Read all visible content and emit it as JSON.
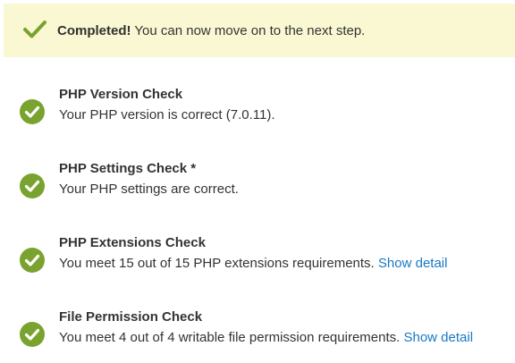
{
  "banner": {
    "icon": "checkmark-icon",
    "strong": "Completed!",
    "message": " You can now move on to the next step.",
    "background": "#f9f8d2",
    "icon_color": "#79a22e"
  },
  "checks": [
    {
      "icon": "success-check-icon",
      "title": "PHP Version Check",
      "description": "Your PHP version is correct (7.0.11)."
    },
    {
      "icon": "success-check-icon",
      "title": "PHP Settings Check *",
      "description": "Your PHP settings are correct."
    },
    {
      "icon": "success-check-icon",
      "title": "PHP Extensions Check",
      "description": "You meet 15 out of 15 PHP extensions requirements.",
      "link": "Show detail"
    },
    {
      "icon": "success-check-icon",
      "title": "File Permission Check",
      "description": "You meet 4 out of 4 writable file permission requirements.",
      "link": "Show detail"
    }
  ],
  "colors": {
    "success": "#79a22e",
    "link": "#1979c3",
    "text": "#333333"
  }
}
